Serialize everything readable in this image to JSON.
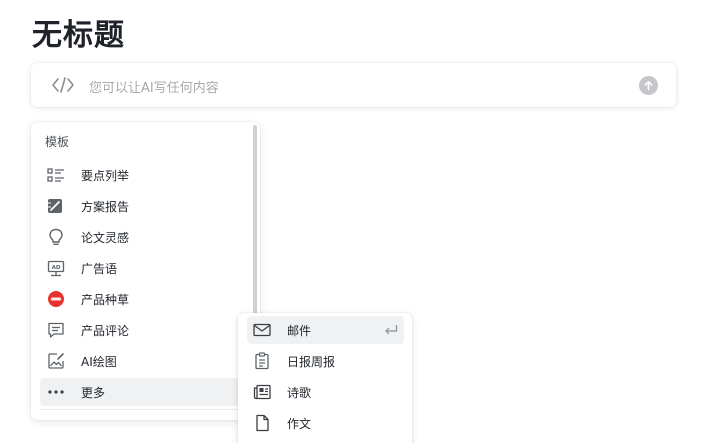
{
  "document": {
    "title": "无标题"
  },
  "ai_input": {
    "placeholder": "您可以让AI写任何内容",
    "code_icon": "code-brackets-icon",
    "send_icon": "arrow-up-icon"
  },
  "template_menu": {
    "section_label": "模板",
    "items": [
      {
        "label": "要点列举",
        "icon": "list-icon"
      },
      {
        "label": "方案报告",
        "icon": "pen-report-icon"
      },
      {
        "label": "论文灵感",
        "icon": "lightbulb-icon"
      },
      {
        "label": "广告语",
        "icon": "ad-board-icon"
      },
      {
        "label": "产品种草",
        "icon": "red-badge-icon"
      },
      {
        "label": "产品评论",
        "icon": "comment-icon"
      },
      {
        "label": "AI绘图",
        "icon": "image-edit-icon"
      },
      {
        "label": "更多",
        "icon": "more-dots-icon"
      }
    ],
    "active_item": "更多"
  },
  "more_submenu": {
    "items": [
      {
        "label": "邮件",
        "icon": "mail-icon"
      },
      {
        "label": "日报周报",
        "icon": "clipboard-icon"
      },
      {
        "label": "诗歌",
        "icon": "newspaper-icon"
      },
      {
        "label": "作文",
        "icon": "document-icon"
      }
    ],
    "active_item": "邮件",
    "enter_icon": "enter-return-icon"
  },
  "colors": {
    "text_primary": "#1f2329",
    "placeholder": "#a6a9ad",
    "hover_bg": "#f0f1f2",
    "badge_red": "#e8322f",
    "icon_gray": "#5f6368"
  }
}
